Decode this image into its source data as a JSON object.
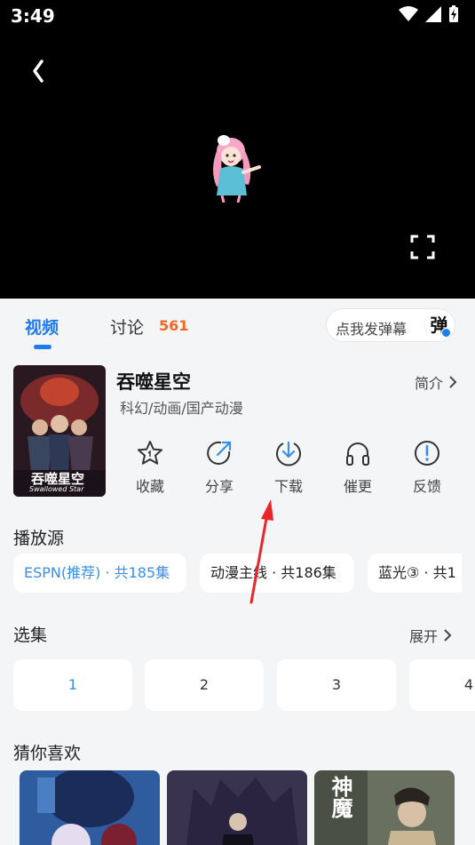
{
  "status_bar": {
    "time": "3:49",
    "icons": [
      "wifi-icon",
      "signal-icon",
      "battery-charging-icon"
    ]
  },
  "player": {
    "icons": [
      "back-icon",
      "mascot-illustration",
      "fullscreen-icon"
    ]
  },
  "tabs": [
    {
      "label": "视频",
      "active": true
    },
    {
      "label": "讨论",
      "count": "561"
    }
  ],
  "danmaku": {
    "label": "点我发弹幕",
    "badge": "弹"
  },
  "show": {
    "title": "吞噬星空",
    "genres": "科幻/动画/国产动漫",
    "intro_label": "简介",
    "poster_text": "吞噬星空",
    "poster_subtext": "Swallowed Star"
  },
  "actions": [
    {
      "label": "收藏",
      "icon": "star-icon"
    },
    {
      "label": "分享",
      "icon": "share-icon"
    },
    {
      "label": "下载",
      "icon": "download-icon"
    },
    {
      "label": "催更",
      "icon": "headphones-icon"
    },
    {
      "label": "反馈",
      "icon": "feedback-icon"
    }
  ],
  "sources": {
    "title": "播放源",
    "items": [
      "ESPN(推荐) · 共185集",
      "动漫主线 · 共186集",
      "蓝光③ · 共1"
    ]
  },
  "episodes": {
    "title": "选集",
    "expand_label": "展开",
    "items": [
      "1",
      "2",
      "3",
      "4"
    ]
  },
  "recommend": {
    "title": "猜你喜欢",
    "poster_text": "神魔"
  },
  "colors": {
    "accent": "#1e7bf0",
    "count": "#f26522",
    "chip_active": "#3a8ee6",
    "annotation_arrow": "#e8262b"
  }
}
